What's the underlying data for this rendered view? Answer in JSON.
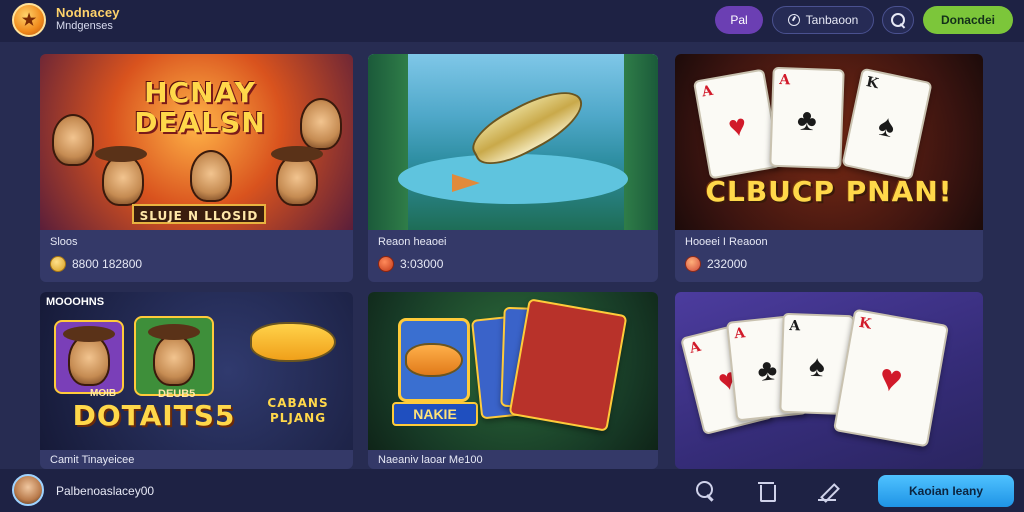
{
  "header": {
    "brand_name": "Nodnacey",
    "brand_sub": "Mndgenses",
    "pill_label": "Pal",
    "history_label": "Tanbaoon",
    "cta_label": "Donacdei"
  },
  "cards": [
    {
      "art_title": "HCNAY DEALSN",
      "art_sub": "SLUJE N LLOSID",
      "caption": "Sloos",
      "value": "8800 182800"
    },
    {
      "art_title": "",
      "art_sub": "",
      "caption": "Reaon heaoei",
      "value": "3:03000"
    },
    {
      "art_title": "CLBUCP PNAN!",
      "art_sub": "",
      "caption": "Hooeei I Reaoon",
      "value": "232000"
    },
    {
      "art_tag": "MOOOHNS",
      "art_title": "DOTAITS5",
      "art_sub_left": "MOIB",
      "art_sub_mid": "DEUB5",
      "art_fish_title": "CABANS PLJANG",
      "caption": "Camit Tinayeicee",
      "value": ""
    },
    {
      "art_badge": "NAKIE",
      "caption": "Naeaniv laoar Me100",
      "value": ""
    },
    {
      "caption": "",
      "value": ""
    }
  ],
  "cards_ranks": {
    "card3": [
      "A",
      "K"
    ],
    "card6": [
      "A",
      "A",
      "A",
      "K"
    ]
  },
  "bottom": {
    "username": "Palbenoaslacey00",
    "cta_label": "Kaoian Ieany"
  },
  "colors": {
    "background": "#272c52",
    "bar": "#1e2244",
    "card": "#343968",
    "accent_green": "#7cc63a",
    "accent_purple": "#6b3fb3",
    "accent_blue": "#1f94e6"
  },
  "icons": [
    "logo-icon",
    "clock-icon",
    "search-icon",
    "trash-icon",
    "edit-icon"
  ]
}
